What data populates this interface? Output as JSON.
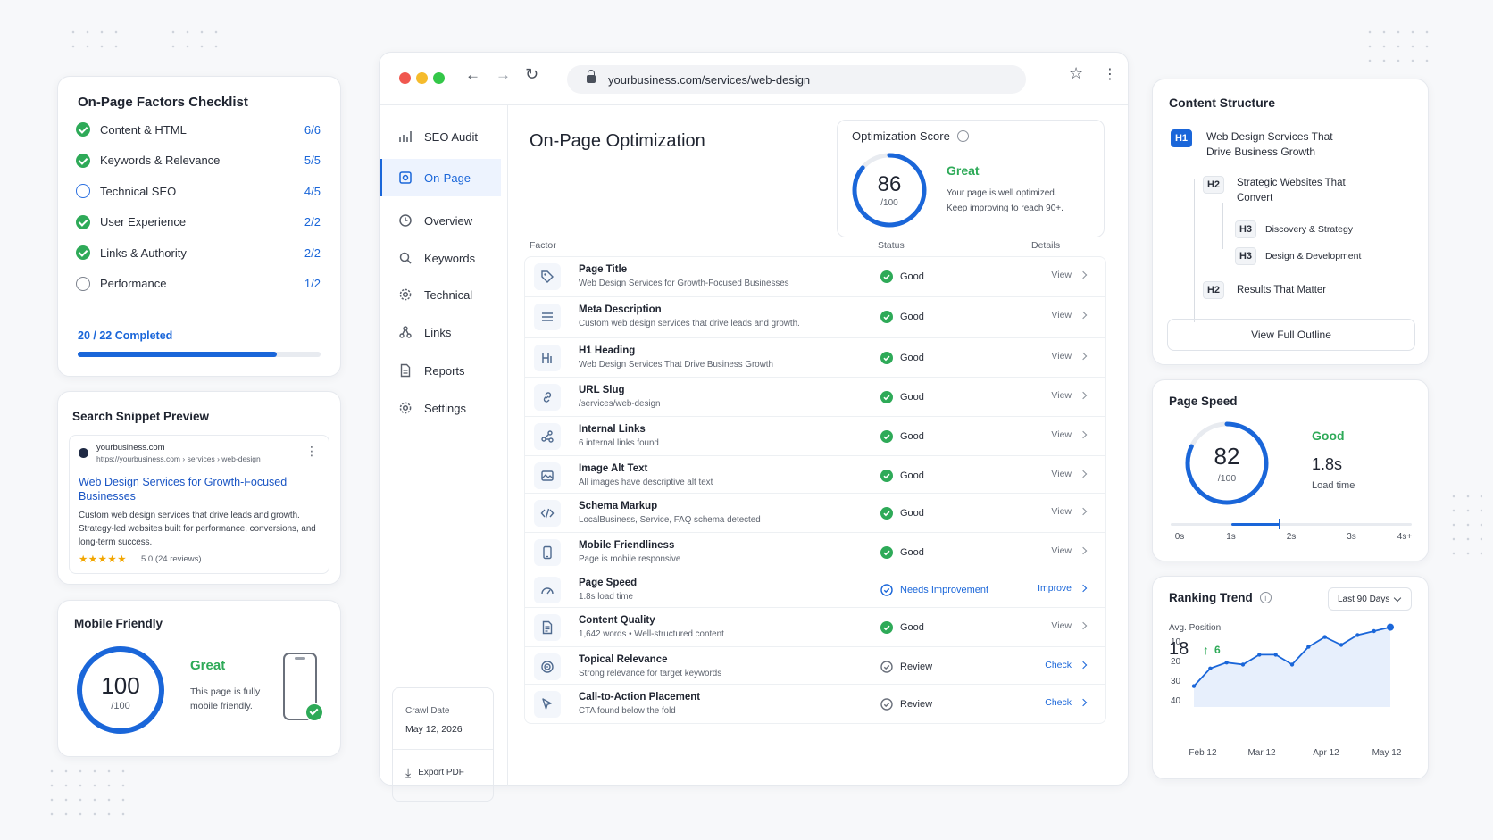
{
  "checklist": {
    "title": "On-Page Factors Checklist",
    "items": [
      {
        "label": "Content & HTML",
        "count": "6/6",
        "state": "done"
      },
      {
        "label": "Keywords & Relevance",
        "count": "5/5",
        "state": "done"
      },
      {
        "label": "Technical SEO",
        "count": "4/5",
        "state": "partial"
      },
      {
        "label": "User Experience",
        "count": "2/2",
        "state": "done"
      },
      {
        "label": "Links & Authority",
        "count": "2/2",
        "state": "done"
      },
      {
        "label": "Performance",
        "count": "1/2",
        "state": "pending"
      }
    ],
    "completed": "20 / 22 Completed",
    "progress": 0.82
  },
  "snippet": {
    "title": "Search Snippet Preview",
    "site": "yourbusiness.com",
    "url": "https://yourbusiness.com › services › web-design",
    "headline": "Web Design Services for Growth-Focused Businesses",
    "description": "Custom web design services that drive leads and growth. Strategy-led websites built for performance, conversions, and long-term success.",
    "stars": "★★★★★",
    "rating": "5.0 (24 reviews)"
  },
  "mobile": {
    "title": "Mobile Friendly",
    "score": "100",
    "of": "/100",
    "status": "Great",
    "desc": "This page is fully mobile friendly."
  },
  "browser": {
    "url": "yourbusiness.com/services/web-design",
    "nav": [
      {
        "label": "SEO Audit",
        "icon": "bar-chart-icon"
      },
      {
        "label": "On-Page",
        "icon": "page-target-icon",
        "active": true
      },
      {
        "label": "Overview",
        "icon": "clock-icon"
      },
      {
        "label": "Keywords",
        "icon": "search-icon"
      },
      {
        "label": "Technical",
        "icon": "gear-icon"
      },
      {
        "label": "Links",
        "icon": "link-nodes-icon"
      },
      {
        "label": "Reports",
        "icon": "document-icon"
      },
      {
        "label": "Settings",
        "icon": "settings-icon"
      }
    ],
    "crawl_label": "Crawl Date",
    "crawl_date": "May 12, 2026",
    "export_label": "Export PDF"
  },
  "main": {
    "title": "On-Page Optimization",
    "score_title": "Optimization Score",
    "score": "86",
    "score_of": "/100",
    "score_progress": 0.86,
    "score_status": "Great",
    "score_desc_1": "Your page is well optimized.",
    "score_desc_2": "Keep improving to reach 90+.",
    "col_factor": "Factor",
    "col_status": "Status",
    "col_details": "Details",
    "factors": [
      {
        "name": "Page Title",
        "desc": "Web Design Services for Growth-Focused Businesses",
        "status": "Good",
        "kind": "good",
        "action": "View",
        "icon": "tag-icon"
      },
      {
        "name": "Meta Description",
        "desc": "Custom web design services that drive leads and growth.",
        "status": "Good",
        "kind": "good",
        "action": "View",
        "icon": "lines-icon"
      },
      {
        "name": "H1 Heading",
        "desc": "Web Design Services That Drive Business Growth",
        "status": "Good",
        "kind": "good",
        "action": "View",
        "icon": "heading-icon"
      },
      {
        "name": "URL Slug",
        "desc": "/services/web-design",
        "status": "Good",
        "kind": "good",
        "action": "View",
        "icon": "link-icon"
      },
      {
        "name": "Internal Links",
        "desc": "6 internal links found",
        "status": "Good",
        "kind": "good",
        "action": "View",
        "icon": "nodes-icon"
      },
      {
        "name": "Image Alt Text",
        "desc": "All images have descriptive alt text",
        "status": "Good",
        "kind": "good",
        "action": "View",
        "icon": "image-icon"
      },
      {
        "name": "Schema Markup",
        "desc": "LocalBusiness, Service, FAQ schema detected",
        "status": "Good",
        "kind": "good",
        "action": "View",
        "icon": "code-icon"
      },
      {
        "name": "Mobile Friendliness",
        "desc": "Page is mobile responsive",
        "status": "Good",
        "kind": "good",
        "action": "View",
        "icon": "phone-icon"
      },
      {
        "name": "Page Speed",
        "desc": "1.8s load time",
        "status": "Needs Improvement",
        "kind": "warn",
        "action": "Improve",
        "icon": "gauge-icon"
      },
      {
        "name": "Content Quality",
        "desc": "1,642 words  •  Well-structured content",
        "status": "Good",
        "kind": "good",
        "action": "View",
        "icon": "doc-icon"
      },
      {
        "name": "Topical Relevance",
        "desc": "Strong relevance for target keywords",
        "status": "Review",
        "kind": "review",
        "action": "Check",
        "icon": "target-icon"
      },
      {
        "name": "Call-to-Action Placement",
        "desc": "CTA found below the fold",
        "status": "Review",
        "kind": "review",
        "action": "Check",
        "icon": "cursor-icon"
      }
    ]
  },
  "structure": {
    "title": "Content Structure",
    "items": [
      {
        "tag": "H1",
        "text": "Web Design Services That Drive Business Growth"
      },
      {
        "tag": "H2",
        "text": "Strategic Websites That Convert"
      },
      {
        "tag": "H3",
        "text": "Discovery & Strategy"
      },
      {
        "tag": "H3",
        "text": "Design & Development"
      },
      {
        "tag": "H2",
        "text": "Results That Matter"
      }
    ],
    "button": "View Full Outline"
  },
  "speed": {
    "title": "Page Speed",
    "score": "82",
    "of": "/100",
    "progress": 0.82,
    "status": "Good",
    "time": "1.8s",
    "time_label": "Load time",
    "ticks": [
      "0s",
      "1s",
      "2s",
      "3s",
      "4s+"
    ],
    "marker": 1.8
  },
  "trend": {
    "title": "Ranking Trend",
    "range": "Last 90 Days",
    "avg_label": "Avg. Position",
    "avg": "18",
    "change": "6",
    "chart_data": {
      "type": "area",
      "x_labels": [
        "Feb 12",
        "Mar 12",
        "Apr 12",
        "May 12"
      ],
      "y_ticks": [
        10,
        20,
        30,
        40
      ],
      "ylim": [
        40,
        5
      ],
      "values": [
        33,
        24,
        21,
        22,
        17,
        17,
        22,
        13,
        8,
        12,
        7,
        5,
        3
      ]
    }
  },
  "colors": {
    "accent": "#1a66d9",
    "good": "#2eaa58"
  }
}
